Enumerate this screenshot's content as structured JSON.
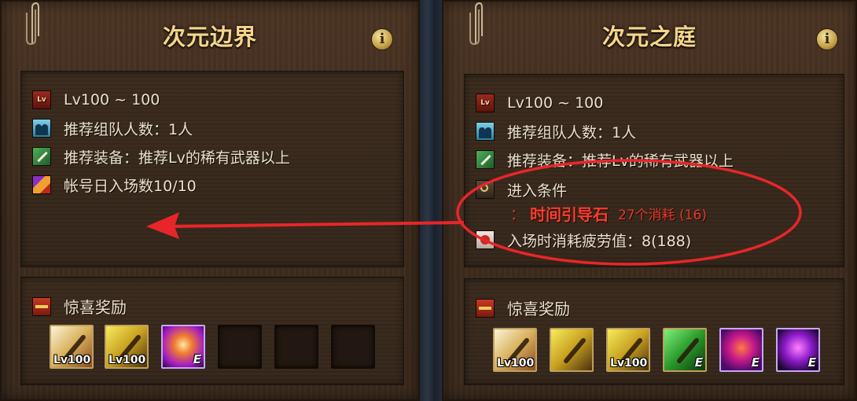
{
  "left": {
    "title": "次元边界",
    "info_icon": "i",
    "level_icon": "Lv",
    "rows": {
      "level": "Lv100 ~ 100",
      "party": "推荐组队人数：1人",
      "equipment": "推荐装备：推荐Lv的稀有武器以上",
      "entries": "帐号日入场数10/10"
    },
    "reward_label": "惊喜奖励",
    "rewards": [
      {
        "icon": "weapon-icon",
        "badge": "Lv100"
      },
      {
        "icon": "weapon-icon",
        "badge": "Lv100"
      },
      {
        "icon": "epic-orb-icon",
        "badge": "E"
      },
      {
        "icon": "empty",
        "badge": ""
      },
      {
        "icon": "empty",
        "badge": ""
      },
      {
        "icon": "empty",
        "badge": ""
      }
    ]
  },
  "right": {
    "title": "次元之庭",
    "info_icon": "i",
    "level_icon": "Lv",
    "rows": {
      "level": "Lv100 ~ 100",
      "party": "推荐组队人数：1人",
      "equipment": "推荐装备：推荐Lv的稀有武器以上",
      "condition": "进入条件",
      "fatigue": "入场时消耗疲劳值：8(188)"
    },
    "condition_detail": {
      "colon": "：",
      "item": "时间引导石",
      "count": "27个消耗 (16)"
    },
    "reward_label": "惊喜奖励",
    "rewards": [
      {
        "icon": "weapon-icon",
        "badge": "Lv100"
      },
      {
        "icon": "weapon-icon",
        "badge": ""
      },
      {
        "icon": "weapon-icon",
        "badge": "Lv100"
      },
      {
        "icon": "weapon-icon",
        "badge": "E"
      },
      {
        "icon": "epic-orb-icon",
        "badge": "E"
      },
      {
        "icon": "epic-orb-icon",
        "badge": "E"
      }
    ]
  },
  "annotation": {
    "arrow_color": "#e8262a",
    "ellipse_color": "#e8262a"
  }
}
